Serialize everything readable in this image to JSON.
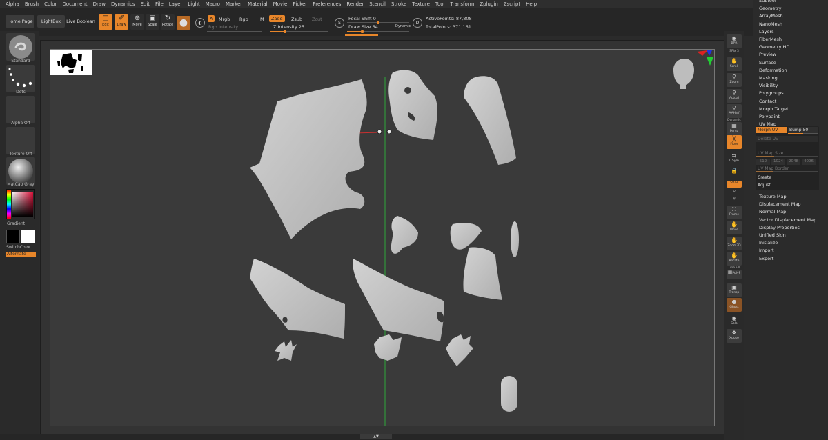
{
  "menu": [
    "Alpha",
    "Brush",
    "Color",
    "Document",
    "Draw",
    "Dynamics",
    "Edit",
    "File",
    "Layer",
    "Light",
    "Macro",
    "Marker",
    "Material",
    "Movie",
    "Picker",
    "Preferences",
    "Render",
    "Stencil",
    "Stroke",
    "Texture",
    "Tool",
    "Transform",
    "Zplugin",
    "Zscript",
    "Help"
  ],
  "toolbar": {
    "home_page": "Home Page",
    "lightbox": "LightBox",
    "live_boolean": "Live Boolean",
    "edit": "Edit",
    "draw": "Draw",
    "move": "Move",
    "scale": "Scale",
    "rotate": "Rotate",
    "a_label": "A",
    "mrgb": "Mrgb",
    "rgb": "Rgb",
    "m": "M",
    "rgb_intensity": "Rgb Intensity",
    "zadd": "Zadd",
    "zsub": "Zsub",
    "zcut": "Zcut",
    "z_intensity_label": "Z Intensity",
    "z_intensity_value": "25",
    "z_intensity_fraction": 0.25,
    "focal_shift_label": "Focal Shift",
    "focal_shift_value": "0",
    "draw_size_label": "Draw Size",
    "draw_size_value": "64",
    "dynamic": "Dynamic",
    "s_label": "S",
    "d_label": "D",
    "active_points_label": "ActivePoints:",
    "active_points_value": "87,808",
    "total_points_label": "TotalPoints:",
    "total_points_value": "371,161"
  },
  "left": {
    "brush": "Standard",
    "stroke": "Dots",
    "alpha": "Alpha Off",
    "texture": "Texture Off",
    "material": "MatCap Gray",
    "gradient": "Gradient",
    "switch_color": "SwitchColor",
    "alternate": "Alternate"
  },
  "shelf": {
    "bpr": "BPR",
    "spix_label": "SPix",
    "spix_value": "3",
    "scroll": "Scroll",
    "zoom": "Zoom",
    "actual": "Actual",
    "aahalf": "AAHalf",
    "dynamic": "Dynamic",
    "persp": "Persp",
    "floor": "Floor",
    "lsym": "L.Sym",
    "qxyz": "Qxyz",
    "frame": "Frame",
    "move": "Move",
    "zoom3d": "Zoom3D",
    "rotate": "Rotate",
    "line_fill": "Line Fill",
    "polyf": "PolyF",
    "transp": "Transp",
    "ghost": "Ghost",
    "solo": "Solo",
    "xpose": "Xpose"
  },
  "palette": {
    "items_top": [
      "Subtool",
      "Geometry",
      "ArrayMesh",
      "NanoMesh",
      "Layers",
      "FiberMesh",
      "Geometry HD",
      "Preview",
      "Surface",
      "Deformation",
      "Masking",
      "Visibility",
      "Polygroups",
      "Contact",
      "Morph Target",
      "Polypaint",
      "UV Map"
    ],
    "morph_uv": "Morph UV",
    "bump_label": "Bump",
    "bump_value": "50",
    "delete_uv": "Delete UV",
    "uv_map_size": "UV Map Size",
    "sizes": [
      "512",
      "1024",
      "2048",
      "4096"
    ],
    "uv_map_border": "UV Map Border",
    "create": "Create",
    "adjust": "Adjust",
    "items_bottom": [
      "Texture Map",
      "Displacement Map",
      "Normal Map",
      "Vector Displacement Map",
      "Display Properties",
      "Unified Skin",
      "Initialize",
      "Import",
      "Export"
    ]
  },
  "colors": {
    "accent": "#e8862a",
    "mesh": "#c8c8c8",
    "canvas": "#3a3a3a"
  }
}
